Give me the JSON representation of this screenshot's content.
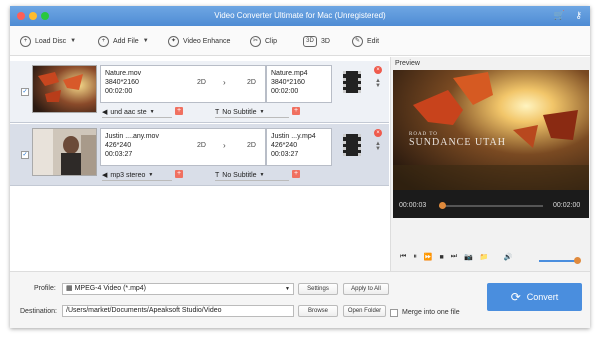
{
  "window": {
    "title": "Video Converter Ultimate for Mac (Unregistered)",
    "traffic_colors": [
      "#ff5f57",
      "#febc2e",
      "#28c840"
    ]
  },
  "toolbar": {
    "load_disc": "Load Disc",
    "add_file": "Add File",
    "video_enhance": "Video Enhance",
    "clip": "Clip",
    "threed": "3D",
    "edit": "Edit"
  },
  "files": [
    {
      "name": "Nature.mov",
      "resolution": "3840*2160",
      "duration": "00:02:00",
      "src_mode": "2D",
      "out_mode": "2D",
      "out_name": "Nature.mp4",
      "out_resolution": "3840*2160",
      "out_duration": "00:02:00",
      "audio": "und aac ste",
      "subtitle": "No Subtitle"
    },
    {
      "name": "Justin ....any.mov",
      "resolution": "426*240",
      "duration": "00:03:27",
      "src_mode": "2D",
      "out_mode": "2D",
      "out_name": "Justin ...y.mp4",
      "out_resolution": "426*240",
      "out_duration": "00:03:27",
      "audio": "mp3 stereo",
      "subtitle": "No Subtitle"
    }
  ],
  "preview": {
    "label": "Preview",
    "overlay_small": "ROAD TO",
    "overlay_title": "SUNDANCE UTAH",
    "current_time": "00:00:03",
    "total_time": "00:02:00",
    "progress": 0.03,
    "volume": 0.95,
    "accent": "#e08a3c"
  },
  "bottom": {
    "profile_label": "Profile:",
    "profile_value": "MPEG-4 Video (*.mp4)",
    "settings": "Settings",
    "apply_all": "Apply to All",
    "destination_label": "Destination:",
    "destination_value": "/Users/market/Documents/Apeaksoft Studio/Video",
    "browse": "Browse",
    "open_folder": "Open Folder",
    "merge": "Merge into one file",
    "convert": "Convert"
  }
}
